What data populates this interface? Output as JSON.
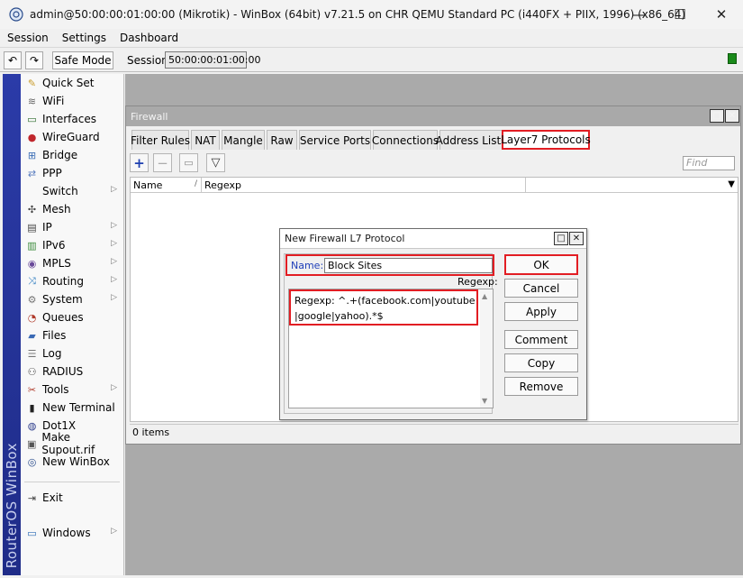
{
  "window": {
    "title": "admin@50:00:00:01:00:00 (Mikrotik) - WinBox (64bit) v7.21.5 on CHR QEMU Standard PC (i440FX + PIIX, 1996) (x86_64)",
    "minimize": "—",
    "maximize": "☐",
    "close": "✕"
  },
  "menu": [
    "Session",
    "Settings",
    "Dashboard"
  ],
  "toolbar": {
    "undo": "↶",
    "redo": "↷",
    "safe_mode": "Safe Mode",
    "session_label": "Session:",
    "session_value": "50:00:00:01:00:00"
  },
  "brand": "RouterOS WinBox",
  "sidebar": [
    {
      "label": "Quick Set",
      "icon": "wand-icon",
      "glyph": "✎",
      "arrow": false
    },
    {
      "label": "WiFi",
      "icon": "wifi-icon",
      "glyph": "≋",
      "arrow": false
    },
    {
      "label": "Interfaces",
      "icon": "interfaces-icon",
      "glyph": "▭",
      "arrow": false
    },
    {
      "label": "WireGuard",
      "icon": "wireguard-icon",
      "glyph": "●",
      "arrow": false
    },
    {
      "label": "Bridge",
      "icon": "bridge-icon",
      "glyph": "⊞",
      "arrow": false
    },
    {
      "label": "PPP",
      "icon": "ppp-icon",
      "glyph": "⇄",
      "arrow": false
    },
    {
      "label": "Switch",
      "icon": "switch-icon",
      "glyph": "",
      "arrow": true
    },
    {
      "label": "Mesh",
      "icon": "mesh-icon",
      "glyph": "✣",
      "arrow": false
    },
    {
      "label": "IP",
      "icon": "ip-icon",
      "glyph": "▤",
      "arrow": true
    },
    {
      "label": "IPv6",
      "icon": "ipv6-icon",
      "glyph": "▥",
      "arrow": true
    },
    {
      "label": "MPLS",
      "icon": "mpls-icon",
      "glyph": "◉",
      "arrow": true
    },
    {
      "label": "Routing",
      "icon": "routing-icon",
      "glyph": "⤨",
      "arrow": true
    },
    {
      "label": "System",
      "icon": "system-icon",
      "glyph": "⚙",
      "arrow": true
    },
    {
      "label": "Queues",
      "icon": "queues-icon",
      "glyph": "◔",
      "arrow": false
    },
    {
      "label": "Files",
      "icon": "files-icon",
      "glyph": "▰",
      "arrow": false
    },
    {
      "label": "Log",
      "icon": "log-icon",
      "glyph": "☰",
      "arrow": false
    },
    {
      "label": "RADIUS",
      "icon": "radius-icon",
      "glyph": "⚇",
      "arrow": false
    },
    {
      "label": "Tools",
      "icon": "tools-icon",
      "glyph": "✂",
      "arrow": true
    },
    {
      "label": "New Terminal",
      "icon": "terminal-icon",
      "glyph": "▮",
      "arrow": false
    },
    {
      "label": "Dot1X",
      "icon": "dot1x-icon",
      "glyph": "◍",
      "arrow": false
    },
    {
      "label": "Make Supout.rif",
      "icon": "supout-icon",
      "glyph": "▣",
      "arrow": false
    },
    {
      "label": "New WinBox",
      "icon": "winbox-icon",
      "glyph": "◎",
      "arrow": false
    },
    {
      "label": "Exit",
      "icon": "exit-icon",
      "glyph": "⇥",
      "arrow": false
    },
    {
      "label": "Windows",
      "icon": "windows-icon",
      "glyph": "▭",
      "arrow": true
    }
  ],
  "firewall": {
    "title": "Firewall",
    "restore": "□",
    "close": "✕",
    "tabs": [
      "Filter Rules",
      "NAT",
      "Mangle",
      "Raw",
      "Service Ports",
      "Connections",
      "Address Lists",
      "Layer7 Protocols"
    ],
    "active_tab": "Layer7 Protocols",
    "tools": {
      "add": "+",
      "remove": "−",
      "comment": "▭",
      "filter": "▽"
    },
    "find_placeholder": "Find",
    "columns": [
      "Name",
      "Regexp"
    ],
    "sort_glyph": "/",
    "dropdown_glyph": "▼",
    "status": "0 items"
  },
  "dialog": {
    "title": "New Firewall L7 Protocol",
    "restore": "□",
    "close": "✕",
    "name_label": "Name:",
    "name_value": "Block Sites",
    "regexp_label": "Regexp:",
    "regexp_value": "Regexp: ^.+(facebook.com|youtube|google|yahoo).*$",
    "buttons": [
      "OK",
      "Cancel",
      "Apply",
      "Comment",
      "Copy",
      "Remove"
    ]
  },
  "colors": {
    "highlight_red": "#e21d23",
    "brand_blue": "#2b3ba8",
    "workarea_gray": "#aaaaaa"
  }
}
